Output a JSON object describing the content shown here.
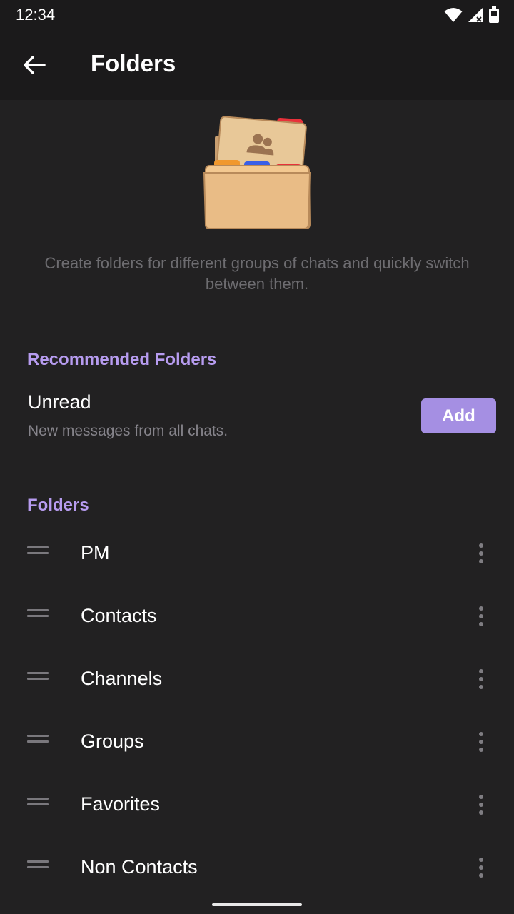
{
  "status_bar": {
    "time": "12:34",
    "icons": [
      "wifi-icon",
      "signal-icon",
      "battery-icon"
    ]
  },
  "app_bar": {
    "title": "Folders",
    "back_icon": "arrow-left-icon"
  },
  "intro": {
    "illustration": "folder-illustration",
    "text": "Create folders for different groups of chats and quickly switch between them."
  },
  "recommended": {
    "header": "Recommended Folders",
    "items": [
      {
        "title": "Unread",
        "subtitle": "New messages from all chats.",
        "button_label": "Add"
      }
    ]
  },
  "folders": {
    "header": "Folders",
    "items": [
      {
        "name": "PM"
      },
      {
        "name": "Contacts"
      },
      {
        "name": "Channels"
      },
      {
        "name": "Groups"
      },
      {
        "name": "Favorites"
      },
      {
        "name": "Non Contacts"
      }
    ]
  },
  "colors": {
    "background": "#222122",
    "app_bar": "#1b1a1b",
    "accent": "#b79cf0",
    "button": "#a58fe3",
    "secondary_text": "#85838a"
  }
}
